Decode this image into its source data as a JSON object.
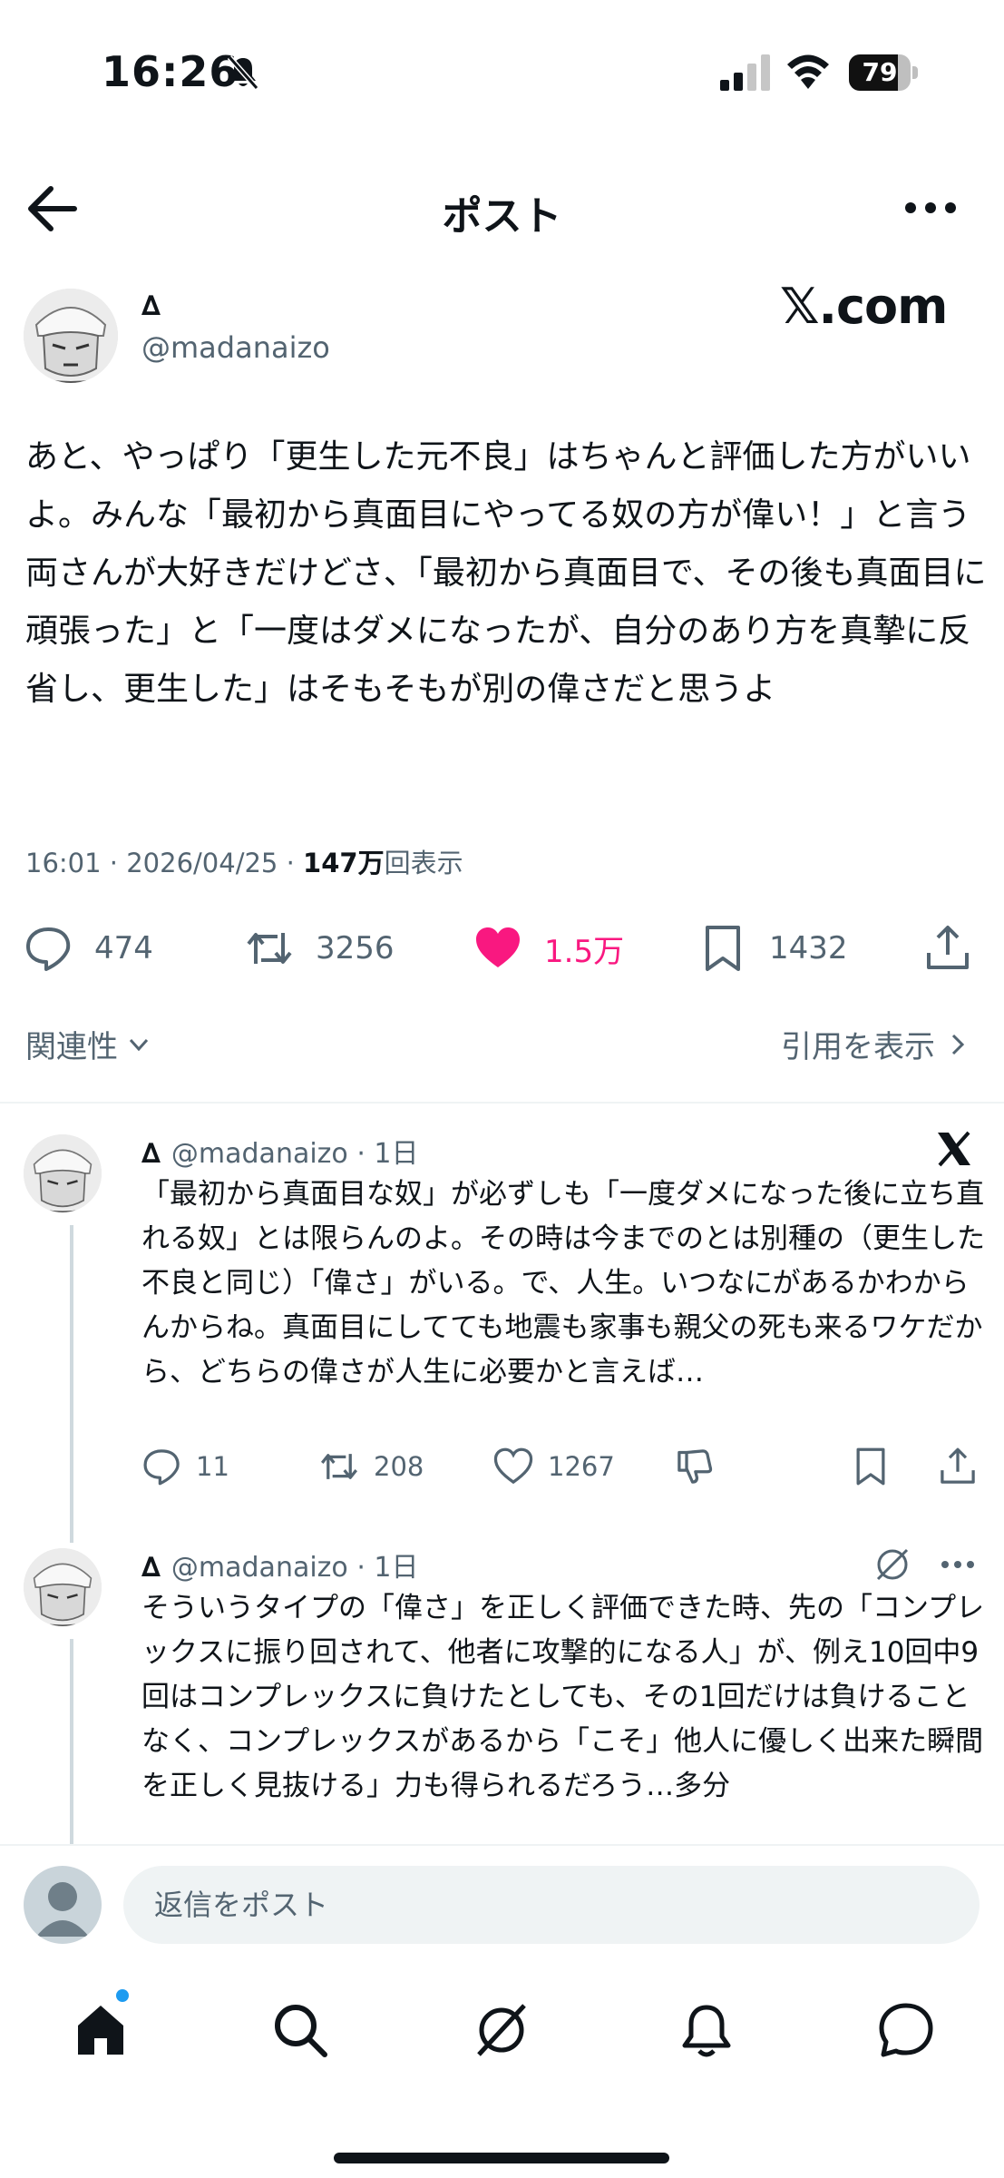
{
  "status_bar": {
    "time": "16:26",
    "battery_level": "79",
    "battery_fraction": 0.79
  },
  "header": {
    "title": "ポスト"
  },
  "post": {
    "author_name": "∆",
    "author_handle": "@madanaizo",
    "watermark": "𝕏.com",
    "text": "あと、やっぱり「更生した元不良」はちゃんと評価した方がいいよ。みんな「最初から真面目にやってる奴の方が偉い！」と言う両さんが大好きだけどさ、「最初から真面目で、その後も真面目に頑張った」と「一度はダメになったが、自分のあり方を真摯に反省し、更生した」はそもそもが別の偉さだと思うよ",
    "time": "16:01",
    "date": "2026/04/25",
    "views_count": "147万",
    "views_label": "回表示",
    "separator": "·",
    "stats": {
      "replies": "474",
      "reposts": "3256",
      "likes": "1.5万",
      "bookmarks": "1432"
    },
    "related_label": "関連性",
    "quotes_label": "引用を表示"
  },
  "replies": [
    {
      "name": "∆",
      "handle": "@madanaizo",
      "time": "1日",
      "text": "「最初から真面目な奴」が必ずしも「一度ダメになった後に立ち直れる奴」とは限らんのよ。その時は今までのとは別種の（更生した不良と同じ）「偉さ」がいる。で、人生。いつなにがあるかわからんからね。真面目にしてても地震も家事も親父の死も来るワケだから、どちらの偉さが人生に必要かと言えば…",
      "stats": {
        "replies": "11",
        "reposts": "208",
        "likes": "1267"
      }
    },
    {
      "name": "∆",
      "handle": "@madanaizo",
      "time": "1日",
      "text": "そういうタイプの「偉さ」を正しく評価できた時、先の「コンプレックスに振り回されて、他者に攻撃的になる人」が、例え10回中9回はコンプレックスに負けたとしても、その1回だけは負けることなく、コンプレックスがあるから「こそ」他人に優しく出来た瞬間を正しく見抜ける」力も得られるだろう…多分"
    }
  ],
  "composer": {
    "placeholder": "返信をポスト"
  },
  "icons": {
    "back": "arrow-left-icon",
    "more": "more-icon",
    "reply": "reply-icon",
    "repost": "repost-icon",
    "like": "heart-icon",
    "bookmark": "bookmark-icon",
    "share": "share-icon",
    "home": "home-icon",
    "search": "search-icon",
    "grok": "grok-icon",
    "notifications": "bell-icon",
    "messages": "messages-icon"
  },
  "colors": {
    "like": "#f91880",
    "secondary_text": "#536471",
    "unread_dot": "#1d9bf0"
  }
}
